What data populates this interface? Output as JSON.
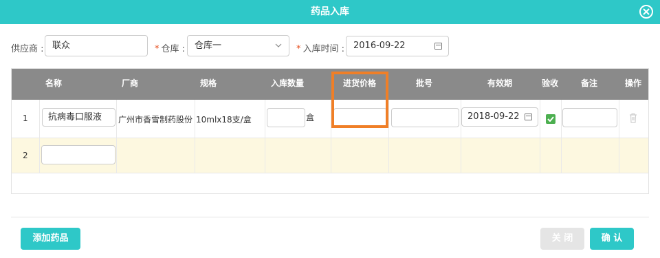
{
  "dialog": {
    "title": "药品入库"
  },
  "form": {
    "supplier_label": "供应商 :",
    "supplier_value": "联众",
    "warehouse_label": "仓库 :",
    "warehouse_value": "仓库一",
    "time_label": "入库时间 :",
    "time_value": "2016-09-22",
    "required_mark": "*"
  },
  "table": {
    "headers": [
      "名称",
      "厂商",
      "规格",
      "入库数量",
      "进货价格",
      "批号",
      "有效期",
      "验收",
      "备注",
      "操作"
    ],
    "row1": {
      "index": "1",
      "name": "抗病毒口服液",
      "manufacturer": "广州市香雪制药股份",
      "spec": "10mlx18支/盒",
      "quantity": "",
      "unit": "盒",
      "price": "",
      "batch": "",
      "expiry": "2018-09-22",
      "accepted": true,
      "remark": ""
    },
    "row2": {
      "index": "2",
      "name": ""
    }
  },
  "footer": {
    "add_label": "添加药品",
    "close_label": "关 闭",
    "confirm_label": "确 认"
  },
  "colors": {
    "accent": "#2ec8c8",
    "header": "#8a8a8a",
    "highlight": "#f07f27",
    "row_highlight": "#fdf8e0"
  }
}
